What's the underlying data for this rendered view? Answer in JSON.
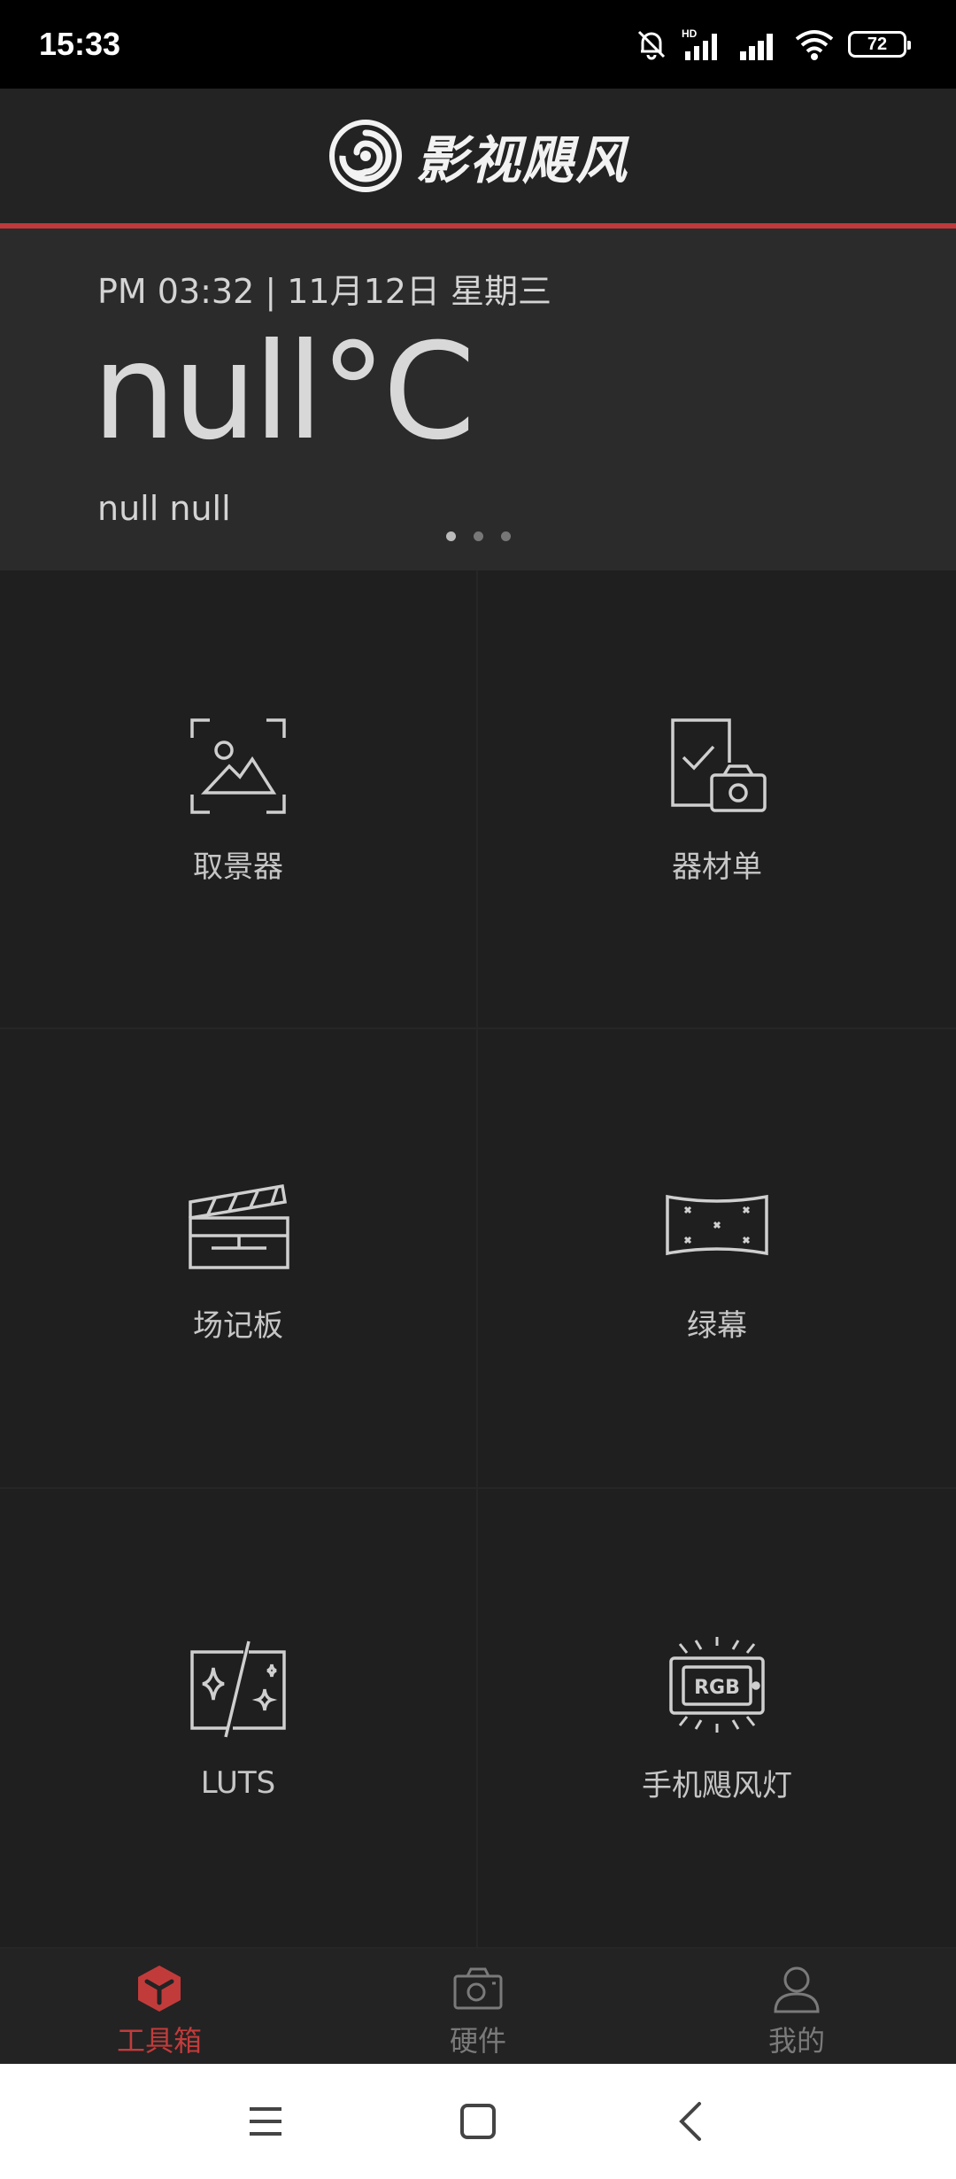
{
  "status_bar": {
    "time": "15:33",
    "battery_level": "72",
    "icons": [
      "bell-off-icon",
      "hd-signal-icon",
      "signal-icon",
      "wifi-icon",
      "battery-icon"
    ]
  },
  "header": {
    "logo_text": "影视飓风",
    "logo_icon": "logo-swirl-icon",
    "accent_color": "#c0393b"
  },
  "weather": {
    "datetime": "PM 03:32 | 11月12日 星期三",
    "temperature": "null°C",
    "location": "null null",
    "pages": 3,
    "active_page": 0
  },
  "tools": [
    {
      "label": "取景器",
      "icon": "viewfinder-icon"
    },
    {
      "label": "器材单",
      "icon": "equipment-list-icon"
    },
    {
      "label": "场记板",
      "icon": "clapperboard-icon"
    },
    {
      "label": "绿幕",
      "icon": "green-screen-icon"
    },
    {
      "label": "LUTS",
      "icon": "luts-icon"
    },
    {
      "label": "手机飓风灯",
      "icon": "rgb-light-icon"
    }
  ],
  "bottom_nav": [
    {
      "label": "工具箱",
      "icon": "toolbox-icon",
      "active": true
    },
    {
      "label": "硬件",
      "icon": "camera-icon",
      "active": false
    },
    {
      "label": "我的",
      "icon": "profile-icon",
      "active": false
    }
  ],
  "system_nav": [
    "menu-icon",
    "home-icon",
    "back-icon"
  ]
}
